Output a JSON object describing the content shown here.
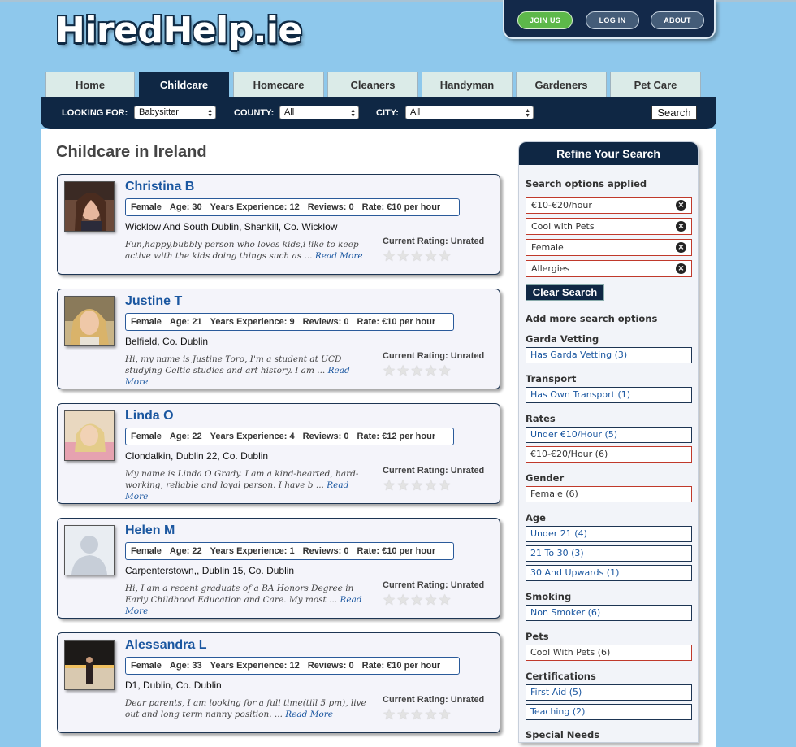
{
  "logo": "HiredHelp.ie",
  "account": {
    "join": "JOIN US",
    "login": "LOG IN",
    "about": "ABOUT"
  },
  "tabs": [
    "Home",
    "Childcare",
    "Homecare",
    "Cleaners",
    "Handyman",
    "Gardeners",
    "Pet Care"
  ],
  "active_tab": "Childcare",
  "search": {
    "looking_label": "LOOKING FOR:",
    "looking_value": "Babysitter",
    "county_label": "COUNTY:",
    "county_value": "All",
    "city_label": "CITY:",
    "city_value": "All",
    "button": "Search"
  },
  "page_title": "Childcare in Ireland",
  "rating_label": "Current Rating: Unrated",
  "read_more": "Read More",
  "profiles": [
    {
      "name": "Christina B",
      "gender": "Female",
      "age": "Age: 30",
      "experience": "Years Experience: 12",
      "reviews": "Reviews: 0",
      "rate": "Rate: €10 per hour",
      "location": "Wicklow And South Dublin, Shankill, Co. Wicklow",
      "description": "Fun,happy,bubbly person who loves kids,i like to keep active with the kids doing things such as ..."
    },
    {
      "name": "Justine T",
      "gender": "Female",
      "age": "Age: 21",
      "experience": "Years Experience: 9",
      "reviews": "Reviews: 0",
      "rate": "Rate: €10 per hour",
      "location": "Belfield, Co. Dublin",
      "description": "Hi, my name is Justine Toro, I'm a student at UCD studying Celtic studies and art history. I am ..."
    },
    {
      "name": "Linda O",
      "gender": "Female",
      "age": "Age: 22",
      "experience": "Years Experience: 4",
      "reviews": "Reviews: 0",
      "rate": "Rate: €12 per hour",
      "location": "Clondalkin, Dublin 22, Co. Dublin",
      "description": "My name is Linda O Grady. I am a kind-hearted, hard-working, reliable and loyal person. I have b ..."
    },
    {
      "name": "Helen M",
      "gender": "Female",
      "age": "Age: 22",
      "experience": "Years Experience: 1",
      "reviews": "Reviews: 0",
      "rate": "Rate: €10 per hour",
      "location": "Carpenterstown,, Dublin 15, Co. Dublin",
      "description": "Hi, I am a recent graduate of a BA Honors Degree in Early Childhood Education and Care. My most ..."
    },
    {
      "name": "Alessandra L",
      "gender": "Female",
      "age": "Age: 33",
      "experience": "Years Experience: 12",
      "reviews": "Reviews: 0",
      "rate": "Rate: €10 per hour",
      "location": "D1, Dublin, Co. Dublin",
      "description": "Dear parents, I am looking for a full time(till 5 pm), live out and long term nanny position. ..."
    }
  ],
  "sidebar": {
    "title": "Refine Your Search",
    "applied_heading": "Search options applied",
    "applied": [
      "€10-€20/hour",
      "Cool with Pets",
      "Female",
      "Allergies"
    ],
    "clear": "Clear Search",
    "more_heading": "Add more search options",
    "groups": [
      {
        "heading": "Garda Vetting",
        "options": [
          "Has Garda Vetting (3)"
        ]
      },
      {
        "heading": "Transport",
        "options": [
          "Has Own Transport (1)"
        ]
      },
      {
        "heading": "Rates",
        "options": [
          "Under €10/Hour (5)",
          "€10-€20/Hour (6)"
        ]
      },
      {
        "heading": "Gender",
        "options": [
          "Female (6)"
        ]
      },
      {
        "heading": "Age",
        "options": [
          "Under 21 (4)",
          "21 To 30 (3)",
          "30 And Upwards (1)"
        ]
      },
      {
        "heading": "Smoking",
        "options": [
          "Non Smoker (6)"
        ]
      },
      {
        "heading": "Pets",
        "options": [
          "Cool With Pets (6)"
        ]
      },
      {
        "heading": "Certifications",
        "options": [
          "First Aid (5)",
          "Teaching (2)"
        ]
      },
      {
        "heading": "Special Needs",
        "options": []
      }
    ]
  },
  "colors": {
    "background": "#8ec8ec",
    "navy": "#0f2744",
    "link": "#1b57a0",
    "selected_border": "#c0392b"
  }
}
